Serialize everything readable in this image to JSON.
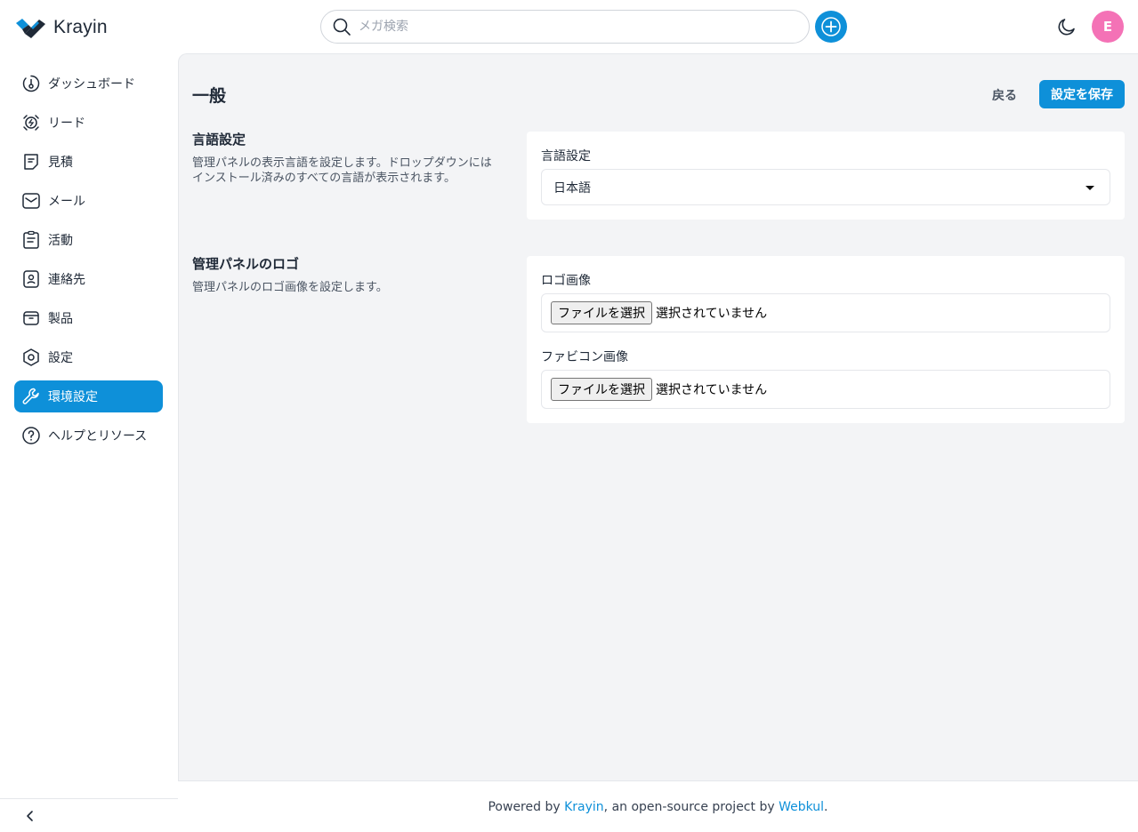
{
  "brand": {
    "name": "Krayin"
  },
  "header": {
    "search_placeholder": "メガ検索",
    "avatar_initial": "E"
  },
  "sidebar": {
    "items": [
      {
        "label": "ダッシュボード",
        "icon": "dashboard-icon"
      },
      {
        "label": "リード",
        "icon": "leads-icon"
      },
      {
        "label": "見積",
        "icon": "quotes-icon"
      },
      {
        "label": "メール",
        "icon": "mail-icon"
      },
      {
        "label": "活動",
        "icon": "activities-icon"
      },
      {
        "label": "連絡先",
        "icon": "contacts-icon"
      },
      {
        "label": "製品",
        "icon": "products-icon"
      },
      {
        "label": "設定",
        "icon": "settings-icon"
      },
      {
        "label": "環境設定",
        "icon": "wrench-icon",
        "active": true
      },
      {
        "label": "ヘルプとリソース",
        "icon": "help-icon"
      }
    ]
  },
  "page": {
    "title": "一般",
    "back_label": "戻る",
    "save_label": "設定を保存"
  },
  "sections": {
    "locale": {
      "title": "言語設定",
      "description": "管理パネルの表示言語を設定します。ドロップダウンにはインストール済みのすべての言語が表示されます。",
      "field_label": "言語設定",
      "selected_value": "日本語"
    },
    "logo": {
      "title": "管理パネルのロゴ",
      "description": "管理パネルのロゴ画像を設定します。",
      "logo_label": "ロゴ画像",
      "favicon_label": "ファビコン画像",
      "file_button": "ファイルを選択",
      "file_status": "選択されていません"
    }
  },
  "footer": {
    "prefix": "Powered by ",
    "link1": "Krayin",
    "middle": ", an open-source project by ",
    "link2": "Webkul",
    "suffix": "."
  },
  "colors": {
    "accent": "#0e90d9",
    "avatar": "#f472b6",
    "main_bg": "#f3f4f6"
  }
}
